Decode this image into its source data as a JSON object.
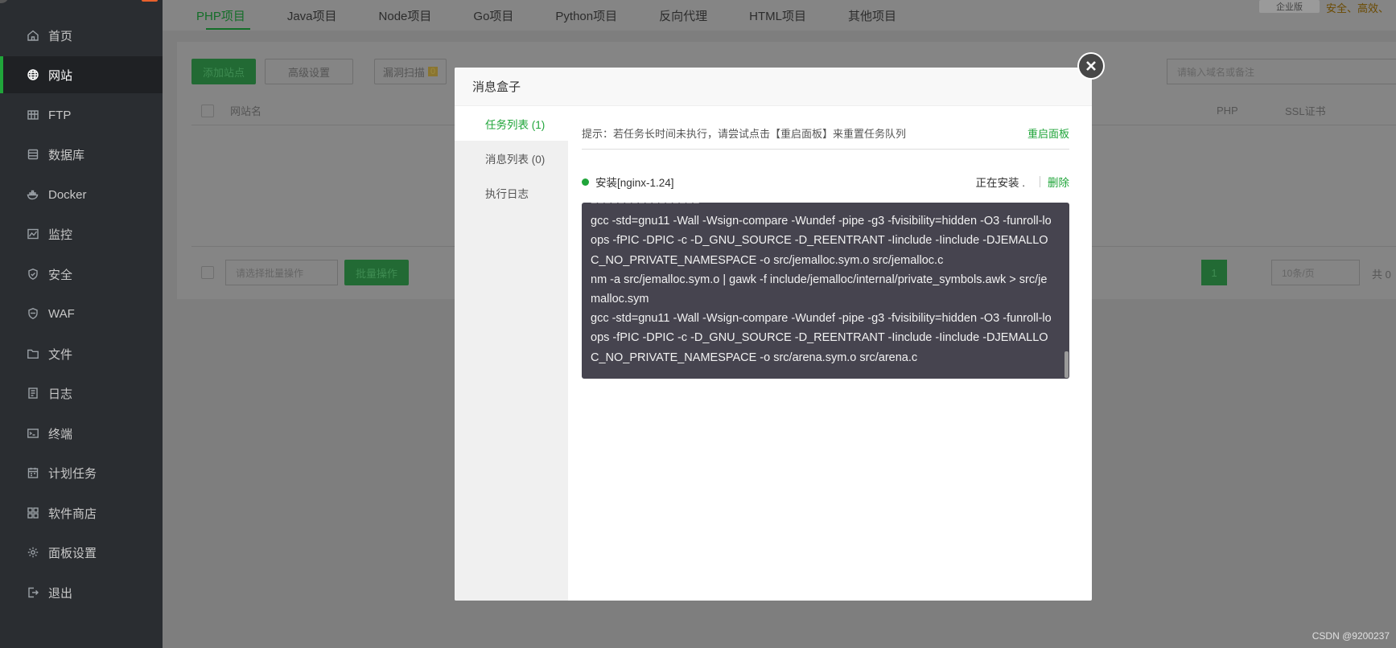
{
  "sidebar": {
    "items": [
      {
        "label": "首页",
        "icon": "home-icon"
      },
      {
        "label": "网站",
        "icon": "globe-icon",
        "active": true
      },
      {
        "label": "FTP",
        "icon": "ftp-icon"
      },
      {
        "label": "数据库",
        "icon": "database-icon"
      },
      {
        "label": "Docker",
        "icon": "docker-icon"
      },
      {
        "label": "监控",
        "icon": "monitor-icon"
      },
      {
        "label": "安全",
        "icon": "shield-icon"
      },
      {
        "label": "WAF",
        "icon": "waf-icon"
      },
      {
        "label": "文件",
        "icon": "folder-icon"
      },
      {
        "label": "日志",
        "icon": "log-icon"
      },
      {
        "label": "终端",
        "icon": "terminal-icon"
      },
      {
        "label": "计划任务",
        "icon": "calendar-icon"
      },
      {
        "label": "软件商店",
        "icon": "grid-icon"
      },
      {
        "label": "面板设置",
        "icon": "gear-icon"
      },
      {
        "label": "退出",
        "icon": "logout-icon"
      }
    ]
  },
  "top_tabs": [
    "PHP项目",
    "Java项目",
    "Node项目",
    "Go项目",
    "Python项目",
    "反向代理",
    "HTML项目",
    "其他项目"
  ],
  "enterprise": {
    "badge": "企业版",
    "tagline": "安全、高效、"
  },
  "background": {
    "add_site": "添加站点",
    "advanced": "高级设置",
    "vuln_scan": "漏洞扫描",
    "vuln_count": "0",
    "search_placeholder": "请输入域名或备注",
    "col_site": "网站名",
    "col_php": "PHP",
    "col_ssl": "SSL证书",
    "batch_select": "请选择批量操作",
    "batch_btn": "批量操作",
    "page_current": "1",
    "page_size": "10条/页",
    "total_prefix": "共 0"
  },
  "modal": {
    "title": "消息盒子",
    "tabs": [
      "任务列表 (1)",
      "消息列表 (0)",
      "执行日志"
    ],
    "tip": "提示：若任务长时间未执行，请尝试点击【重启面板】来重置任务队列",
    "restart_link": "重启面板",
    "task_name": "安装[nginx-1.24]",
    "task_status": "正在安装 .",
    "delete_link": "删除",
    "log_lines": [
      "================",
      "gcc -std=gnu11 -Wall -Wsign-compare -Wundef -pipe -g3 -fvisibility=hidden -O3 -funroll-loops -fPIC -DPIC -c -D_GNU_SOURCE -D_REENTRANT -Iinclude -Iinclude -DJEMALLOC_NO_PRIVATE_NAMESPACE -o src/jemalloc.sym.o src/jemalloc.c",
      "nm -a src/jemalloc.sym.o | gawk -f include/jemalloc/internal/private_symbols.awk > src/jemalloc.sym",
      "gcc -std=gnu11 -Wall -Wsign-compare -Wundef -pipe -g3 -fvisibility=hidden -O3 -funroll-loops -fPIC -DPIC -c -D_GNU_SOURCE -D_REENTRANT -Iinclude -Iinclude -DJEMALLOC_NO_PRIVATE_NAMESPACE -o src/arena.sym.o src/arena.c"
    ]
  },
  "watermark": "CSDN @9200237"
}
